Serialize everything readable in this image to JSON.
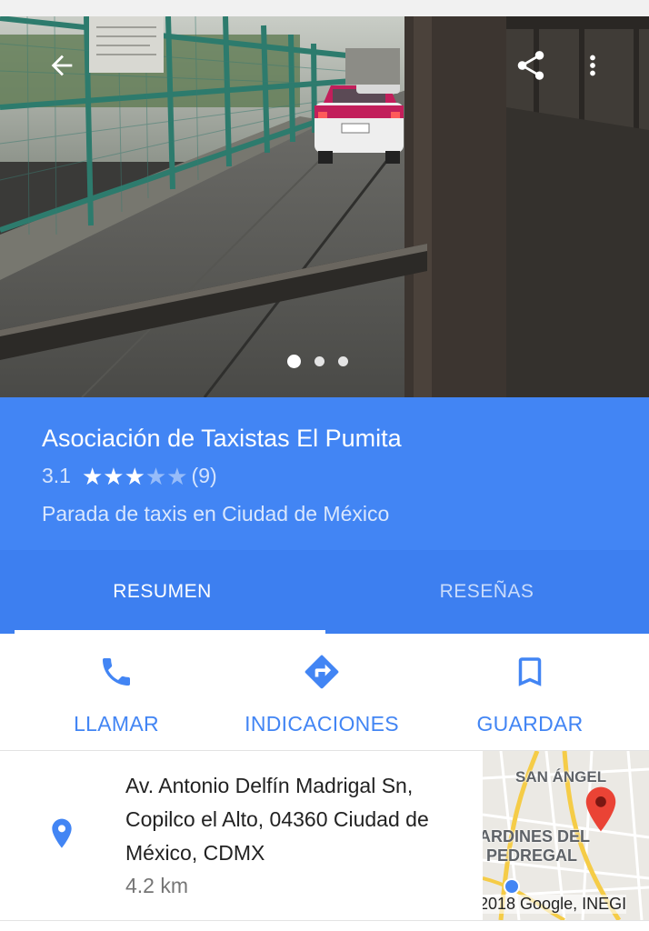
{
  "header": {
    "back_icon": "arrow-back-icon",
    "share_icon": "share-icon",
    "more_icon": "more-vert-icon",
    "photo_pager": {
      "count": 3,
      "active": 1
    }
  },
  "place": {
    "name": "Asociación de Taxistas El Pumita",
    "rating": "3.1",
    "stars": 3,
    "review_count": "(9)",
    "category": "Parada de taxis en Ciudad de México"
  },
  "tabs": [
    {
      "label": "RESUMEN",
      "selected": true
    },
    {
      "label": "RESEÑAS",
      "selected": false
    }
  ],
  "actions": [
    {
      "label": "LLAMAR",
      "icon": "phone-icon"
    },
    {
      "label": "INDICACIONES",
      "icon": "directions-icon"
    },
    {
      "label": "GUARDAR",
      "icon": "bookmark-icon"
    }
  ],
  "address": {
    "text": "Av. Antonio Delfín Madrigal Sn, Copilco el Alto, 04360 Ciudad de México, CDMX",
    "distance": "4.2 km",
    "icon": "place-pin-icon"
  },
  "map": {
    "labels": [
      "SAN ÁNGEL",
      "ARDINES DEL",
      "PEDREGAL"
    ],
    "attribution": "2018 Google, INEGI"
  },
  "colors": {
    "primary": "#4285f4",
    "tab_bar": "#3d7ff0",
    "map_pin": "#ea4335"
  }
}
